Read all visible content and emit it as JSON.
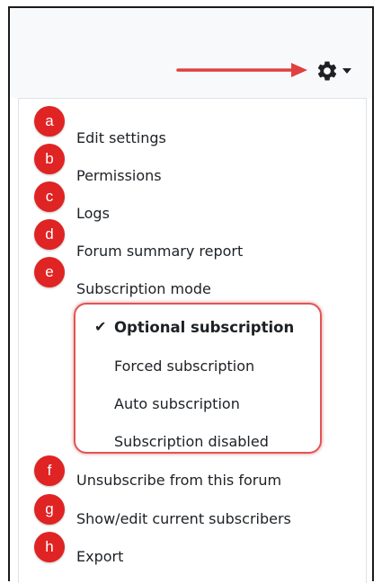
{
  "settings_menu": {
    "toggle_icon": "gear-icon",
    "items": [
      {
        "badge": "a",
        "label": "Edit settings"
      },
      {
        "badge": "b",
        "label": "Permissions"
      },
      {
        "badge": "c",
        "label": "Logs"
      },
      {
        "badge": "d",
        "label": "Forum summary report"
      },
      {
        "badge": "e",
        "label": "Subscription mode"
      },
      {
        "badge": "f",
        "label": "Unsubscribe from this forum"
      },
      {
        "badge": "g",
        "label": "Show/edit current subscribers"
      },
      {
        "badge": "h",
        "label": "Export"
      }
    ],
    "subscription_options": [
      {
        "label": "Optional subscription",
        "selected": true
      },
      {
        "label": "Forced subscription",
        "selected": false
      },
      {
        "label": "Auto subscription",
        "selected": false
      },
      {
        "label": "Subscription disabled",
        "selected": false
      }
    ]
  },
  "annotation_colors": {
    "badge": "#e02323",
    "arrow": "#e04040",
    "highlight": "#e05555"
  }
}
